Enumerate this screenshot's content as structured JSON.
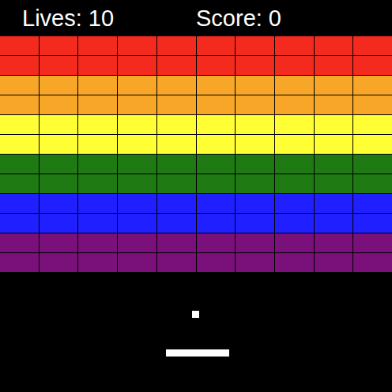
{
  "hud": {
    "lives": "Lives: 10",
    "score": "Score: 0"
  },
  "rows": [
    {
      "color": "#f52a1e",
      "bricks": [
        {
          "present": true
        },
        {
          "present": true
        },
        {
          "present": true
        },
        {
          "present": true
        },
        {
          "present": true
        },
        {
          "present": true
        },
        {
          "present": true
        },
        {
          "present": true
        },
        {
          "present": true
        },
        {
          "present": true
        }
      ]
    },
    {
      "color": "#f52a1e",
      "bricks": [
        {
          "present": true
        },
        {
          "present": true
        },
        {
          "present": true
        },
        {
          "present": true
        },
        {
          "present": true
        },
        {
          "present": true
        },
        {
          "present": true
        },
        {
          "present": true
        },
        {
          "present": true
        },
        {
          "present": true
        }
      ]
    },
    {
      "color": "#f8a628",
      "bricks": [
        {
          "present": true
        },
        {
          "present": true
        },
        {
          "present": true
        },
        {
          "present": true
        },
        {
          "present": true
        },
        {
          "present": true
        },
        {
          "present": true
        },
        {
          "present": true
        },
        {
          "present": true
        },
        {
          "present": true
        }
      ]
    },
    {
      "color": "#f8a628",
      "bricks": [
        {
          "present": true
        },
        {
          "present": true
        },
        {
          "present": true
        },
        {
          "present": true
        },
        {
          "present": true
        },
        {
          "present": true
        },
        {
          "present": true
        },
        {
          "present": true
        },
        {
          "present": true
        },
        {
          "present": true
        }
      ]
    },
    {
      "color": "#ffff33",
      "bricks": [
        {
          "present": true
        },
        {
          "present": true
        },
        {
          "present": true
        },
        {
          "present": true
        },
        {
          "present": true
        },
        {
          "present": true
        },
        {
          "present": true
        },
        {
          "present": true
        },
        {
          "present": true
        },
        {
          "present": true
        }
      ]
    },
    {
      "color": "#ffff33",
      "bricks": [
        {
          "present": true
        },
        {
          "present": true
        },
        {
          "present": true
        },
        {
          "present": true
        },
        {
          "present": true
        },
        {
          "present": true
        },
        {
          "present": true
        },
        {
          "present": true
        },
        {
          "present": true
        },
        {
          "present": true
        }
      ]
    },
    {
      "color": "#1f7a14",
      "bricks": [
        {
          "present": true
        },
        {
          "present": true
        },
        {
          "present": true
        },
        {
          "present": true
        },
        {
          "present": true
        },
        {
          "present": true
        },
        {
          "present": true
        },
        {
          "present": true
        },
        {
          "present": true
        },
        {
          "present": true
        }
      ]
    },
    {
      "color": "#1f7a14",
      "bricks": [
        {
          "present": true
        },
        {
          "present": true
        },
        {
          "present": true
        },
        {
          "present": true
        },
        {
          "present": true
        },
        {
          "present": true
        },
        {
          "present": true
        },
        {
          "present": true
        },
        {
          "present": true
        },
        {
          "present": true
        }
      ]
    },
    {
      "color": "#1f1fff",
      "bricks": [
        {
          "present": true
        },
        {
          "present": true
        },
        {
          "present": true
        },
        {
          "present": true
        },
        {
          "present": true
        },
        {
          "present": true
        },
        {
          "present": true
        },
        {
          "present": true
        },
        {
          "present": true
        },
        {
          "present": true
        }
      ]
    },
    {
      "color": "#1f1fff",
      "bricks": [
        {
          "present": true
        },
        {
          "present": true
        },
        {
          "present": true
        },
        {
          "present": true
        },
        {
          "present": true
        },
        {
          "present": true
        },
        {
          "present": true
        },
        {
          "present": true
        },
        {
          "present": true
        },
        {
          "present": true
        }
      ]
    },
    {
      "color": "#7a107a",
      "bricks": [
        {
          "present": true
        },
        {
          "present": true
        },
        {
          "present": true
        },
        {
          "present": true
        },
        {
          "present": true
        },
        {
          "present": true
        },
        {
          "present": true
        },
        {
          "present": true
        },
        {
          "present": true
        },
        {
          "present": true
        }
      ]
    },
    {
      "color": "#7a107a",
      "bricks": [
        {
          "present": true
        },
        {
          "present": true
        },
        {
          "present": true
        },
        {
          "present": true
        },
        {
          "present": true
        },
        {
          "present": true
        },
        {
          "present": true
        },
        {
          "present": true
        },
        {
          "present": true
        },
        {
          "present": true
        }
      ]
    }
  ]
}
